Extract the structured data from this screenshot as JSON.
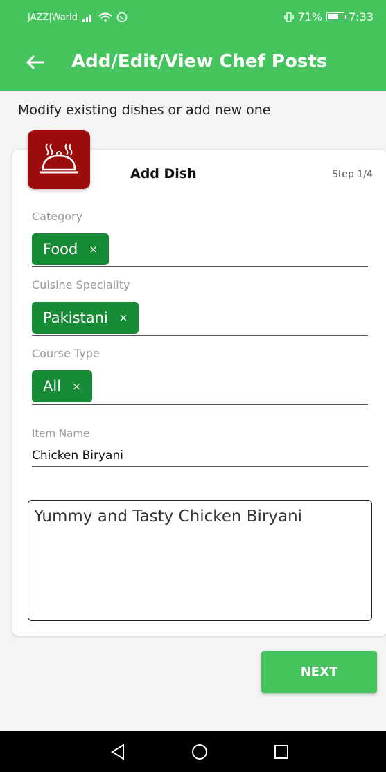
{
  "status_bar": {
    "carrier": "JAZZ|Warid",
    "battery_percent": "71%",
    "time": "7:33"
  },
  "app_bar": {
    "title": "Add/Edit/View Chef Posts"
  },
  "subtitle": "Modify existing dishes or add new one",
  "card": {
    "title": "Add Dish",
    "step": "Step 1/4",
    "category": {
      "label": "Category",
      "chip": "Food"
    },
    "cuisine": {
      "label": "Cuisine Speciality",
      "chip": "Pakistani"
    },
    "course": {
      "label": "Course Type",
      "chip": "All"
    },
    "item_name": {
      "label": "Item Name",
      "value": "Chicken Biryani"
    },
    "description": "Yummy and Tasty Chicken Biryani"
  },
  "next_label": "NEXT",
  "chip_close_glyph": "×",
  "colors": {
    "primary": "#45c35d",
    "chip": "#178a35",
    "logo": "#9b0d0d"
  }
}
